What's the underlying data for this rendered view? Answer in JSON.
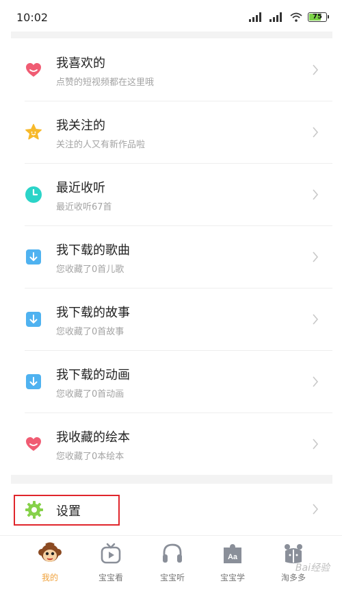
{
  "status_bar": {
    "time": "10:02",
    "battery": "75",
    "battery_level": 0.75,
    "colors": {
      "battery": "#7cd348"
    }
  },
  "list": {
    "items": [
      {
        "title": "我喜欢的",
        "subtitle": "点赞的短视频都在这里哦",
        "icon": "heart-icon",
        "color": "#f05c73"
      },
      {
        "title": "我关注的",
        "subtitle": "关注的人又有新作品啦",
        "icon": "star-icon",
        "color": "#f7b92b"
      },
      {
        "title": "最近收听",
        "subtitle": "最近收听67首",
        "icon": "clock-icon",
        "color": "#2bd4c8"
      },
      {
        "title": "我下载的歌曲",
        "subtitle": "您收藏了0首儿歌",
        "icon": "download-icon",
        "color": "#4fb2f0"
      },
      {
        "title": "我下载的故事",
        "subtitle": "您收藏了0首故事",
        "icon": "download-icon",
        "color": "#4fb2f0"
      },
      {
        "title": "我下载的动画",
        "subtitle": "您收藏了0首动画",
        "icon": "download-icon",
        "color": "#4fb2f0"
      },
      {
        "title": "我收藏的绘本",
        "subtitle": "您收藏了0本绘本",
        "icon": "heart-icon",
        "color": "#f05c73"
      }
    ]
  },
  "settings": {
    "label": "设置",
    "icon": "gear-icon",
    "color": "#86d14a",
    "highlight_color": "#e0252b"
  },
  "tabbar": {
    "tabs": [
      {
        "label": "我的",
        "icon": "monkey-avatar-icon",
        "active": true
      },
      {
        "label": "宝宝看",
        "icon": "video-play-icon",
        "active": false
      },
      {
        "label": "宝宝听",
        "icon": "headphones-icon",
        "active": false
      },
      {
        "label": "宝宝学",
        "icon": "puzzle-aa-icon",
        "active": false
      },
      {
        "label": "淘多多",
        "icon": "gift-bear-icon",
        "active": false
      }
    ],
    "active_color": "#f0a13a"
  },
  "watermark": "Bai经验"
}
